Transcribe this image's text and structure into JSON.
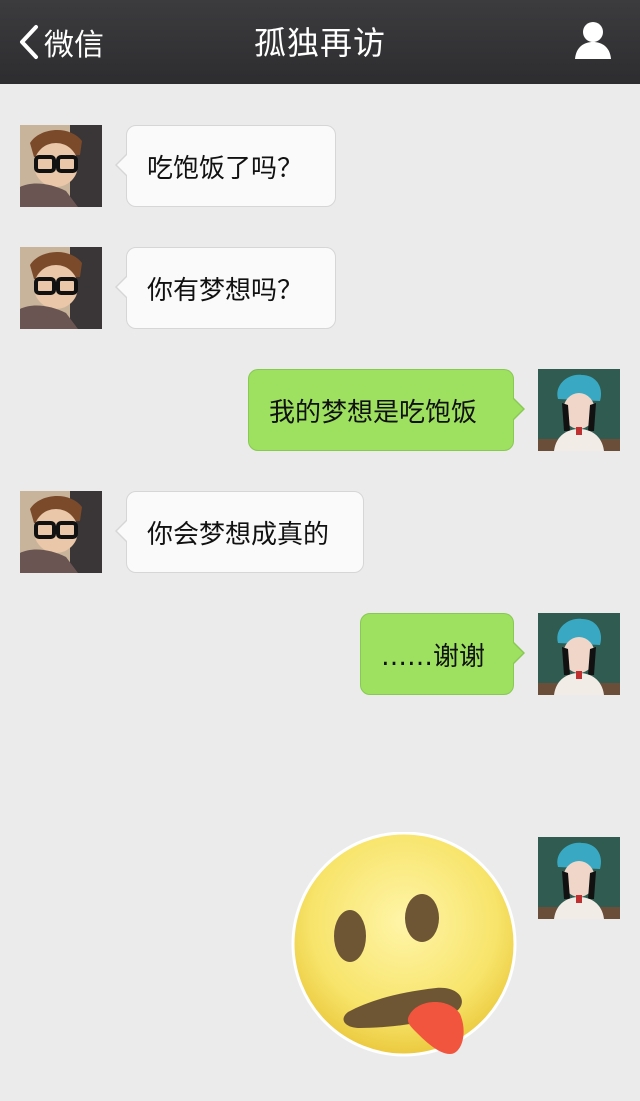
{
  "navbar": {
    "back_label": "微信",
    "title": "孤独再访",
    "icons": [
      "chevron-left-icon",
      "person-icon"
    ]
  },
  "messages": [
    {
      "side": "in",
      "text": "吃饱饭了吗？"
    },
    {
      "side": "in",
      "text": "你有梦想吗？"
    },
    {
      "side": "out",
      "text": "我的梦想是吃饱饭"
    },
    {
      "side": "in",
      "text": "你会梦想成真的"
    },
    {
      "side": "out",
      "text": "……谢谢"
    },
    {
      "side": "out",
      "sticker": "tongue-out-emoji"
    }
  ],
  "colors": {
    "navbar": "#353538",
    "background": "#ebebeb",
    "incoming_bubble": "#fafafa",
    "outgoing_bubble": "#9ee05f"
  }
}
